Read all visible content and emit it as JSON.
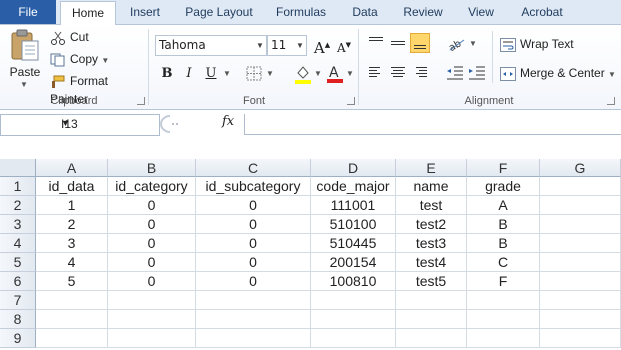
{
  "tabs": {
    "file": "File",
    "items": [
      "Home",
      "Insert",
      "Page Layout",
      "Formulas",
      "Data",
      "Review",
      "View",
      "Acrobat"
    ]
  },
  "ribbon": {
    "clipboard": {
      "label": "Clipboard",
      "paste": "Paste",
      "cut": "Cut",
      "copy": "Copy",
      "format_painter": "Format Painter"
    },
    "font": {
      "label": "Font",
      "font_name": "Tahoma",
      "font_size": "11",
      "bold": "B",
      "italic": "I",
      "underline": "U",
      "grow": "A",
      "shrink": "A"
    },
    "alignment": {
      "label": "Alignment",
      "wrap_text": "Wrap Text",
      "merge_center": "Merge & Center"
    }
  },
  "formula_bar": {
    "name_box": "I13",
    "fx": "fx",
    "formula": ""
  },
  "sheet": {
    "columns": [
      "A",
      "B",
      "C",
      "D",
      "E",
      "F",
      "G"
    ],
    "rows": [
      [
        "id_data",
        "id_category",
        "id_subcategory",
        "code_major",
        "name",
        "grade",
        ""
      ],
      [
        "1",
        "0",
        "0",
        "111001",
        "test",
        "A",
        ""
      ],
      [
        "2",
        "0",
        "0",
        "510100",
        "test2",
        "B",
        ""
      ],
      [
        "3",
        "0",
        "0",
        "510445",
        "test3",
        "B",
        ""
      ],
      [
        "4",
        "0",
        "0",
        "200154",
        "test4",
        "C",
        ""
      ],
      [
        "5",
        "0",
        "0",
        "100810",
        "test5",
        "F",
        ""
      ],
      [
        "",
        "",
        "",
        "",
        "",
        "",
        ""
      ],
      [
        "",
        "",
        "",
        "",
        "",
        "",
        ""
      ],
      [
        "",
        "",
        "",
        "",
        "",
        "",
        ""
      ]
    ],
    "row_numbers": [
      "1",
      "2",
      "3",
      "4",
      "5",
      "6",
      "7",
      "8",
      "9"
    ]
  },
  "colors": {
    "file_tab": "#2a5fa8",
    "ribbon_bg": "#f3f6fb",
    "highlight": "#ffd66b",
    "font_color_bar": "#e02020",
    "fill_color_bar": "#ffff00"
  }
}
